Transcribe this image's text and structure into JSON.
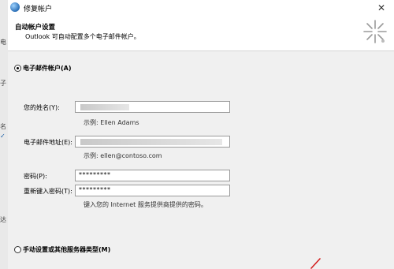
{
  "window": {
    "title": "修复帐户"
  },
  "header": {
    "title": "自动帐户设置",
    "subtitle": "Outlook 可自动配置多个电子邮件帐户。"
  },
  "behind": {
    "chars": [
      "电",
      "子",
      "名",
      "✓",
      "达"
    ]
  },
  "email_account_option": {
    "label": "电子邮件帐户(A)",
    "selected": true
  },
  "form": {
    "name": {
      "label": "您的姓名(Y):",
      "value": "",
      "example": "示例: Ellen Adams"
    },
    "email": {
      "label": "电子邮件地址(E):",
      "value": "",
      "example": "示例: ellen@contoso.com"
    },
    "password": {
      "label": "密码(P):",
      "value": "*********"
    },
    "retype_password": {
      "label": "重新键入密码(T):",
      "value": "*********"
    },
    "password_hint": "键入您的 Internet 服务提供商提供的密码。"
  },
  "manual_option": {
    "label": "手动设置或其他服务器类型(M)",
    "selected": false
  },
  "colors": {
    "accent": "#1a5ea8",
    "background": "#f0f0f0",
    "field_border": "#9a9a9a"
  }
}
